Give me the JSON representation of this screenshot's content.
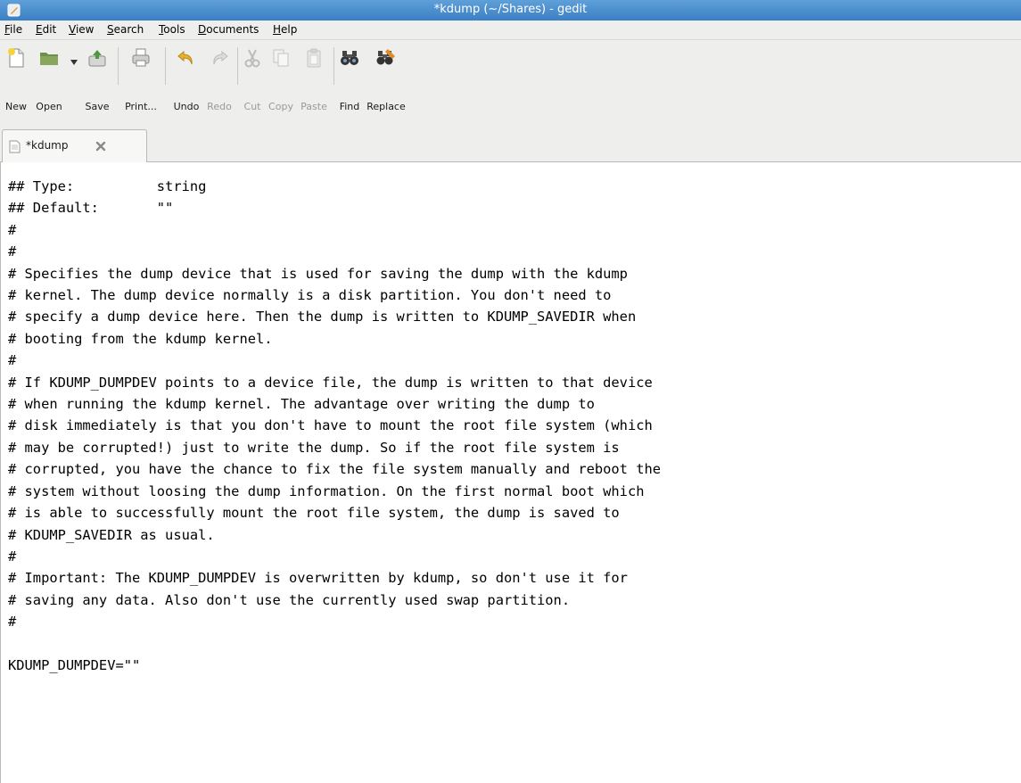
{
  "window": {
    "title": "*kdump (~/Shares) - gedit"
  },
  "menubar": {
    "items": [
      {
        "accel": "F",
        "rest": "ile"
      },
      {
        "accel": "E",
        "rest": "dit"
      },
      {
        "accel": "V",
        "rest": "iew"
      },
      {
        "accel": "S",
        "rest": "earch"
      },
      {
        "accel": "T",
        "rest": "ools"
      },
      {
        "accel": "D",
        "rest": "ocuments"
      },
      {
        "accel": "H",
        "rest": "elp"
      }
    ]
  },
  "toolbar": {
    "new_label": "New",
    "open_label": "Open",
    "save_label": "Save",
    "print_label": "Print...",
    "undo_label": "Undo",
    "redo_label": "Redo",
    "cut_label": "Cut",
    "copy_label": "Copy",
    "paste_label": "Paste",
    "find_label": "Find",
    "replace_label": "Replace"
  },
  "tabs": [
    {
      "label": "*kdump"
    }
  ],
  "icons": {
    "app": "text-editor-icon",
    "new": "new-document-icon",
    "open": "folder-open-icon",
    "open_menu": "chevron-down-icon",
    "save": "save-icon",
    "print": "printer-icon",
    "undo": "undo-icon",
    "redo": "redo-icon",
    "cut": "scissors-icon",
    "copy": "copy-icon",
    "paste": "paste-icon",
    "find": "binoculars-icon",
    "replace": "replace-icon",
    "tab_doc": "document-icon",
    "tab_close": "close-icon"
  },
  "editor": {
    "content": "## Type:          string\n## Default:       \"\"\n#\n#\n# Specifies the dump device that is used for saving the dump with the kdump\n# kernel. The dump device normally is a disk partition. You don't need to\n# specify a dump device here. Then the dump is written to KDUMP_SAVEDIR when\n# booting from the kdump kernel.\n#\n# If KDUMP_DUMPDEV points to a device file, the dump is written to that device\n# when running the kdump kernel. The advantage over writing the dump to\n# disk immediately is that you don't have to mount the root file system (which\n# may be corrupted!) just to write the dump. So if the root file system is\n# corrupted, you have the chance to fix the file system manually and reboot the\n# system without loosing the dump information. On the first normal boot which\n# is able to successfully mount the root file system, the dump is saved to\n# KDUMP_SAVEDIR as usual.\n#\n# Important: The KDUMP_DUMPDEV is overwritten by kdump, so don't use it for\n# saving any data. Also don't use the currently used swap partition.\n#\n\nKDUMP_DUMPDEV=\"\""
  }
}
